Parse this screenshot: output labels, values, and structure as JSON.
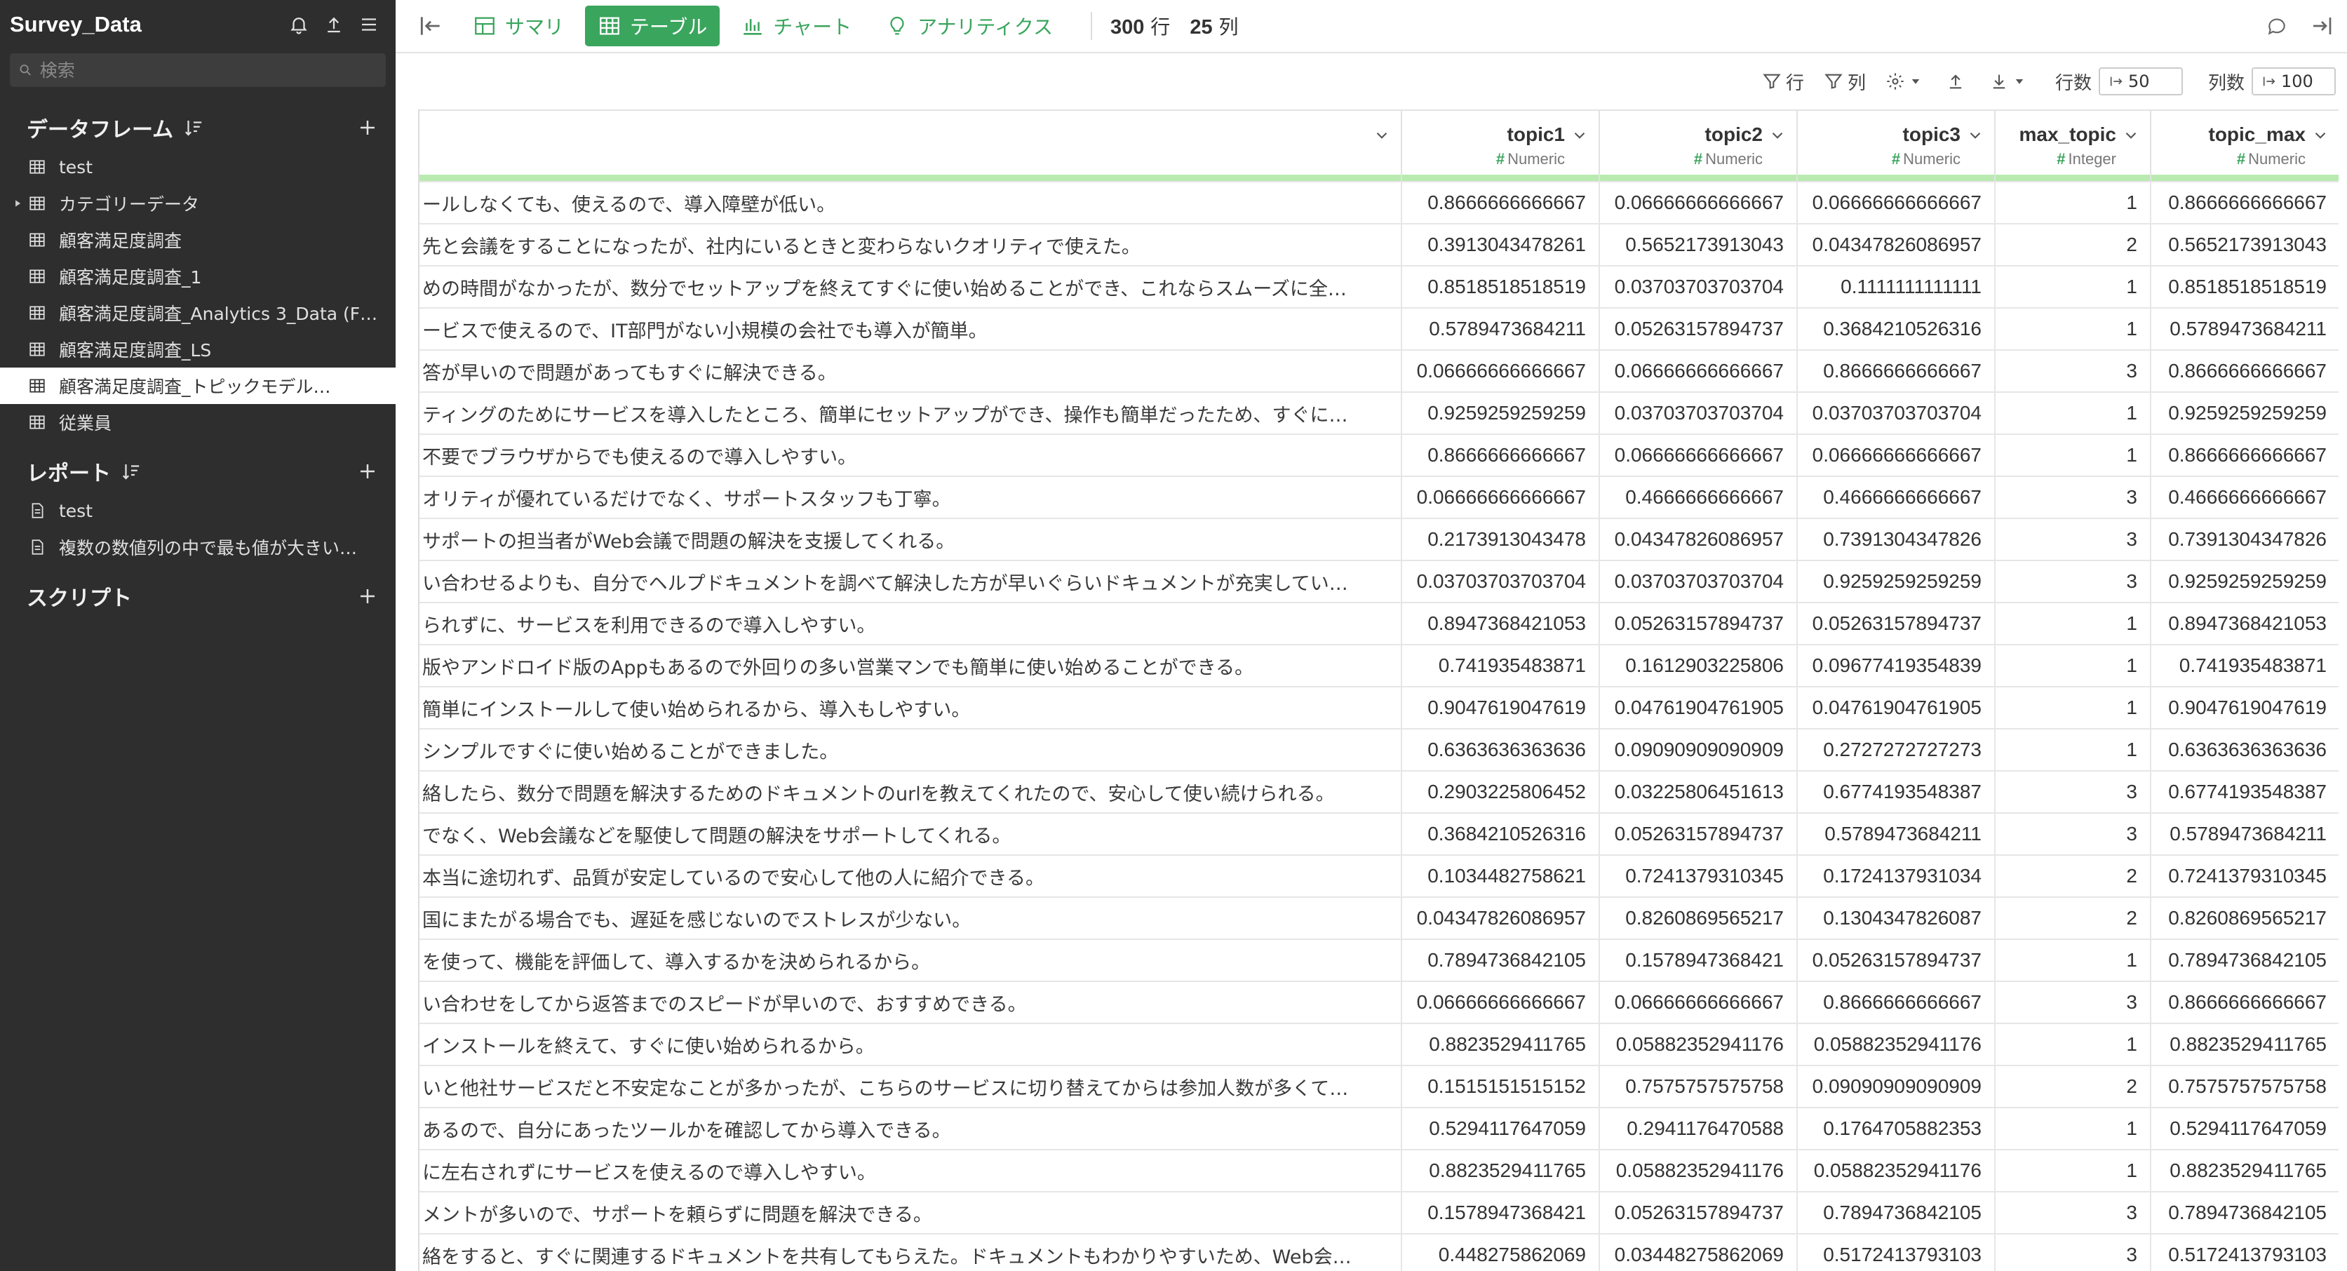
{
  "sidebar": {
    "project_name": "Survey_Data",
    "search_placeholder": "検索",
    "dataframes": {
      "title": "データフレーム",
      "items": [
        {
          "label": "test",
          "expandable": false,
          "selected": false
        },
        {
          "label": "カテゴリーデータ",
          "expandable": true,
          "selected": false
        },
        {
          "label": "顧客満足度調査",
          "expandable": false,
          "selected": false
        },
        {
          "label": "顧客満足度調査_1",
          "expandable": false,
          "selected": false
        },
        {
          "label": "顧客満足度調査_Analytics 3_Data (F…",
          "expandable": false,
          "selected": false
        },
        {
          "label": "顧客満足度調査_LS",
          "expandable": false,
          "selected": false
        },
        {
          "label": "顧客満足度調査_トピックモデル…",
          "expandable": false,
          "selected": true
        },
        {
          "label": "従業員",
          "expandable": false,
          "selected": false
        }
      ]
    },
    "reports": {
      "title": "レポート",
      "items": [
        {
          "label": "test"
        },
        {
          "label": "複数の数値列の中で最も値が大きい…"
        }
      ]
    },
    "scripts": {
      "title": "スクリプト"
    }
  },
  "toolbar": {
    "tabs": [
      {
        "label": "サマリ",
        "icon": "summary-icon",
        "active": false
      },
      {
        "label": "テーブル",
        "icon": "table-icon",
        "active": true
      },
      {
        "label": "チャート",
        "icon": "chart-icon",
        "active": false
      },
      {
        "label": "アナリティクス",
        "icon": "analytics-icon",
        "active": false
      }
    ],
    "rows_count": "300",
    "rows_unit": "行",
    "cols_count": "25",
    "cols_unit": "列"
  },
  "subbar": {
    "row_filter": "行",
    "col_filter": "列",
    "row_count_label": "行数",
    "row_count_value": "50",
    "col_count_label": "列数",
    "col_count_value": "100"
  },
  "table": {
    "columns": [
      {
        "name": "",
        "type": ""
      },
      {
        "name": "topic1",
        "type": "Numeric"
      },
      {
        "name": "topic2",
        "type": "Numeric"
      },
      {
        "name": "topic3",
        "type": "Numeric"
      },
      {
        "name": "max_topic",
        "type": "Integer"
      },
      {
        "name": "topic_max",
        "type": "Numeric"
      }
    ],
    "rows": [
      [
        "ールしなくても、使えるので、導入障壁が低い。",
        "0.8666666666667",
        "0.06666666666667",
        "0.06666666666667",
        "1",
        "0.8666666666667"
      ],
      [
        "先と会議をすることになったが、社内にいるときと変わらないクオリティで使えた。",
        "0.3913043478261",
        "0.5652173913043",
        "0.04347826086957",
        "2",
        "0.5652173913043"
      ],
      [
        "めの時間がなかったが、数分でセットアップを終えてすぐに使い始めることができ、これならスムーズに全…",
        "0.8518518518519",
        "0.03703703703704",
        "0.1111111111111",
        "1",
        "0.8518518518519"
      ],
      [
        "ービスで使えるので、IT部門がない小規模の会社でも導入が簡単。",
        "0.5789473684211",
        "0.05263157894737",
        "0.3684210526316",
        "1",
        "0.5789473684211"
      ],
      [
        "答が早いので問題があってもすぐに解決できる。",
        "0.06666666666667",
        "0.06666666666667",
        "0.8666666666667",
        "3",
        "0.8666666666667"
      ],
      [
        "ティングのためにサービスを導入したところ、簡単にセットアップができ、操作も簡単だったため、すぐに…",
        "0.9259259259259",
        "0.03703703703704",
        "0.03703703703704",
        "1",
        "0.9259259259259"
      ],
      [
        "不要でブラウザからでも使えるので導入しやすい。",
        "0.8666666666667",
        "0.06666666666667",
        "0.06666666666667",
        "1",
        "0.8666666666667"
      ],
      [
        "オリティが優れているだけでなく、サポートスタッフも丁寧。",
        "0.06666666666667",
        "0.4666666666667",
        "0.4666666666667",
        "3",
        "0.4666666666667"
      ],
      [
        "サポートの担当者がWeb会議で問題の解決を支援してくれる。",
        "0.2173913043478",
        "0.04347826086957",
        "0.7391304347826",
        "3",
        "0.7391304347826"
      ],
      [
        "い合わせるよりも、自分でヘルプドキュメントを調べて解決した方が早いぐらいドキュメントが充実してい…",
        "0.03703703703704",
        "0.03703703703704",
        "0.9259259259259",
        "3",
        "0.9259259259259"
      ],
      [
        "られずに、サービスを利用できるので導入しやすい。",
        "0.8947368421053",
        "0.05263157894737",
        "0.05263157894737",
        "1",
        "0.8947368421053"
      ],
      [
        "版やアンドロイド版のAppもあるので外回りの多い営業マンでも簡単に使い始めることができる。",
        "0.741935483871",
        "0.1612903225806",
        "0.09677419354839",
        "1",
        "0.741935483871"
      ],
      [
        "簡単にインストールして使い始められるから、導入もしやすい。",
        "0.9047619047619",
        "0.04761904761905",
        "0.04761904761905",
        "1",
        "0.9047619047619"
      ],
      [
        "シンプルですぐに使い始めることができました。",
        "0.6363636363636",
        "0.09090909090909",
        "0.2727272727273",
        "1",
        "0.6363636363636"
      ],
      [
        "絡したら、数分で問題を解決するためのドキュメントのurlを教えてくれたので、安心して使い続けられる。",
        "0.2903225806452",
        "0.03225806451613",
        "0.6774193548387",
        "3",
        "0.6774193548387"
      ],
      [
        "でなく、Web会議などを駆使して問題の解決をサポートしてくれる。",
        "0.3684210526316",
        "0.05263157894737",
        "0.5789473684211",
        "3",
        "0.5789473684211"
      ],
      [
        "本当に途切れず、品質が安定しているので安心して他の人に紹介できる。",
        "0.1034482758621",
        "0.7241379310345",
        "0.1724137931034",
        "2",
        "0.7241379310345"
      ],
      [
        "国にまたがる場合でも、遅延を感じないのでストレスが少ない。",
        "0.04347826086957",
        "0.8260869565217",
        "0.1304347826087",
        "2",
        "0.8260869565217"
      ],
      [
        "を使って、機能を評価して、導入するかを決められるから。",
        "0.7894736842105",
        "0.1578947368421",
        "0.05263157894737",
        "1",
        "0.7894736842105"
      ],
      [
        "い合わせをしてから返答までのスピードが早いので、おすすめできる。",
        "0.06666666666667",
        "0.06666666666667",
        "0.8666666666667",
        "3",
        "0.8666666666667"
      ],
      [
        "インストールを終えて、すぐに使い始められるから。",
        "0.8823529411765",
        "0.05882352941176",
        "0.05882352941176",
        "1",
        "0.8823529411765"
      ],
      [
        "いと他社サービスだと不安定なことが多かったが、こちらのサービスに切り替えてからは参加人数が多くて…",
        "0.1515151515152",
        "0.7575757575758",
        "0.09090909090909",
        "2",
        "0.7575757575758"
      ],
      [
        "あるので、自分にあったツールかを確認してから導入できる。",
        "0.5294117647059",
        "0.2941176470588",
        "0.1764705882353",
        "1",
        "0.5294117647059"
      ],
      [
        "に左右されずにサービスを使えるので導入しやすい。",
        "0.8823529411765",
        "0.05882352941176",
        "0.05882352941176",
        "1",
        "0.8823529411765"
      ],
      [
        "メントが多いので、サポートを頼らずに問題を解決できる。",
        "0.1578947368421",
        "0.05263157894737",
        "0.7894736842105",
        "3",
        "0.7894736842105"
      ],
      [
        "絡をすると、すぐに関連するドキュメントを共有してもらえた。ドキュメントもわかりやすいため、Web会…",
        "0.448275862069",
        "0.03448275862069",
        "0.5172413793103",
        "3",
        "0.5172413793103"
      ]
    ]
  },
  "colors": {
    "accent": "#3aa55d",
    "sidebar_bg": "#2e2e2e",
    "highlight_line": "#b9ebb0"
  }
}
